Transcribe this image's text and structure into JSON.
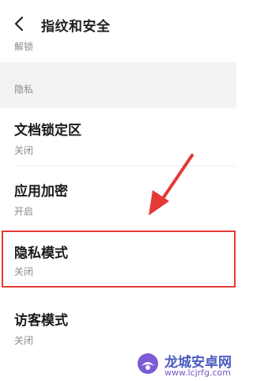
{
  "header": {
    "title": "指纹和安全"
  },
  "top_item": {
    "status": "解锁"
  },
  "privacy_section": {
    "label": "隐私"
  },
  "items": [
    {
      "title": "文档锁定区",
      "status": "关闭"
    },
    {
      "title": "应用加密",
      "status": "开启"
    },
    {
      "title": "隐私模式",
      "status": "关闭"
    },
    {
      "title": "访客模式",
      "status": "关闭"
    }
  ],
  "watermark": {
    "name": "龙城安卓网",
    "url": "www.lcjrfg.com"
  },
  "colors": {
    "highlight": "#e53935",
    "secondary_text": "#8a8a8a",
    "section_bg": "#f3f3f3"
  }
}
